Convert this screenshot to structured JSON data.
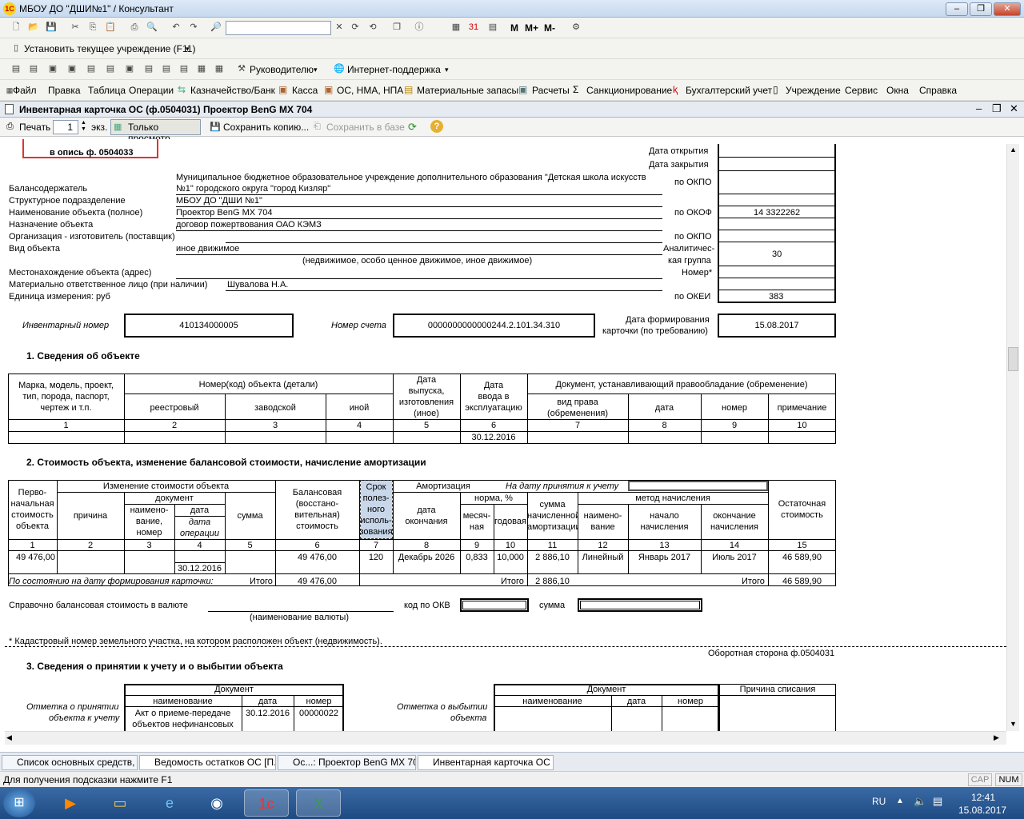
{
  "window": {
    "title": "МБОУ ДО \"ДШИ№1\" / Консультант"
  },
  "toolbar2": {
    "set_institution": "Установить текущее учреждение (F11)"
  },
  "toolbar3": {
    "managers": "Руководителю",
    "internet_support": "Интернет-поддержка"
  },
  "toolbar1": {
    "m1": "M",
    "m2": "M+",
    "m3": "M-"
  },
  "menu": [
    "Файл",
    "Правка",
    "Таблица",
    "Операции",
    "Казначейство/Банк",
    "Касса",
    "ОС, НМА, НПА",
    "Материальные запасы",
    "Расчеты",
    "Санкционирование",
    "Бухгалтерский учет",
    "Учреждение",
    "Сервис",
    "Окна",
    "Справка"
  ],
  "form": {
    "title": "Инвентарная карточка ОС (ф.0504031) Проектор BenG MX 704",
    "print": "Печать",
    "copies": "1",
    "copies_unit": "экз.",
    "view_only": "Только просмотр",
    "save_copy": "Сохранить копию...",
    "save_db": "Сохранить в базе",
    "help": "?"
  },
  "doc": {
    "stamp": "в опись ф. 0504033",
    "right": {
      "open_date": "Дата открытия",
      "close_date": "Дата закрытия",
      "okpo": "по ОКПО",
      "okof": "по ОКОФ",
      "okof_val": "14 3322262",
      "okpo2": "по ОКПО",
      "analytic1": "Аналитичес-",
      "analytic2": "кая группа",
      "analytic_val": "30",
      "number": "Номер*",
      "okei": "по ОКЕИ",
      "okei_val": "383"
    },
    "rows": {
      "holder_label": "Балансодержатель",
      "holder_val1": "Муниципальное бюджетное образовательное учреждение дополнительного образования  \"Детская школа искусств",
      "holder_val2": "№1\" городского округа \"город Кизляр\"",
      "unit_label": "Структурное подразделение",
      "unit_val": "МБОУ ДО \"ДШИ №1\"",
      "name_label": "Наименование объекта (полное)",
      "name_val": "Проектор BenG MX 704",
      "purpose_label": "Назначение объекта",
      "purpose_val": "договор пожертвования ОАО КЭМЗ",
      "maker_label": "Организация - изготовитель (поставщик)",
      "type_label": "Вид объекта",
      "type_val": "иное движимое",
      "type_hint": "(недвижимое, особо ценное движимое, иное движимое)",
      "location_label": "Местонахождение объекта (адрес)",
      "responsible_label": "Материально ответственное лицо (при наличии)",
      "responsible_val": "Шувалова Н.А.",
      "measure_label": "Единица измерения: руб"
    },
    "inv": {
      "inv_label": "Инвентарный номер",
      "inv_val": "410134000005",
      "acc_label": "Номер счета",
      "acc_val": "0000000000000244.2.101.34.310",
      "date_label1": "Дата формирования",
      "date_label2": "карточки (по требованию)",
      "date_val": "15.08.2017"
    },
    "s1": {
      "title": "1. Сведения об объекте",
      "h_brand": [
        "Марка, модель, проект,",
        "тип, порода, паспорт,",
        "чертеж и т.п."
      ],
      "h_number": "Номер(код) объекта (детали)",
      "h_reg": "реестровый",
      "h_factory": "заводской",
      "h_other": "иной",
      "h_release": [
        "Дата",
        "выпуска,",
        "изготовления",
        "(иное)"
      ],
      "h_commission": [
        "Дата",
        "ввода в",
        "эксплуатацию"
      ],
      "h_doc": "Документ, устанавливающий правообладание (обременение)",
      "h_right": [
        "вид права",
        "(обременения)"
      ],
      "h_date": "дата",
      "h_num": "номер",
      "h_note": "примечание",
      "nums": [
        "1",
        "2",
        "3",
        "4",
        "5",
        "6",
        "7",
        "8",
        "9",
        "10"
      ],
      "commission_val": "30.12.2016"
    },
    "s2": {
      "title": "2. Стоимость объекта, изменение балансовой стоимости, начисление амортизации",
      "h_initial": [
        "Перво-",
        "начальная",
        "стоимость",
        "объекта"
      ],
      "h_change": "Изменение стоимости объекта",
      "h_reason": "причина",
      "h_document": "документ",
      "h_dname": [
        "наимено-",
        "вание,",
        "номер"
      ],
      "h_ddate": "дата",
      "h_ddate2": [
        "дата",
        "операции"
      ],
      "h_sum": "сумма",
      "h_balance": [
        "Балансовая",
        "(восстано-",
        "вительная)",
        "стоимость"
      ],
      "h_life": [
        "Срок",
        "полез-",
        "ного",
        "исполь-",
        "зования"
      ],
      "h_amort": "Амортизация",
      "h_on_date": "На дату принятия к учету",
      "h_end": [
        "дата",
        "окончания"
      ],
      "h_norm": "норма, %",
      "h_month": [
        "месяч-",
        "ная"
      ],
      "h_year": "годовая",
      "h_accrued": [
        "сумма",
        "начисленной",
        "амортизации"
      ],
      "h_method": "метод начисления",
      "h_mname": [
        "наимено-",
        "вание"
      ],
      "h_mstart": [
        "начало",
        "начисления"
      ],
      "h_mend": [
        "окончание",
        "начисления"
      ],
      "h_rest": [
        "Остаточная",
        "стоимость"
      ],
      "nums": [
        "1",
        "2",
        "3",
        "4",
        "5",
        "6",
        "7",
        "8",
        "9",
        "10",
        "11",
        "12",
        "13",
        "14",
        "15"
      ],
      "row": {
        "initial": "49 476,00",
        "opdate": "30.12.2016",
        "balance": "49 476,00",
        "life": "120",
        "end": "Декабрь 2026",
        "month": "0,833",
        "year": "10,000",
        "accrued": "2 886,10",
        "method": "Линейный",
        "start": "Январь 2017",
        "mend": "Июль 2017",
        "rest": "46 589,90"
      },
      "as_of": "По состоянию на дату формирования карточки:",
      "total": "Итого",
      "total_balance": "49 476,00",
      "total_accrued": "2 886,10",
      "total_rest": "46 589,90",
      "ref": "Справочно балансовая стоимость в валюте",
      "currency_hint": "(наименование валюты)",
      "okv": "код по ОКВ",
      "sum": "сумма",
      "footnote": "* Кадастровый номер земельного участка, на котором расположен объект (недвижимость).",
      "back": "Оборотная сторона ф.0504031"
    },
    "s3": {
      "title": "3. Сведения о принятии к учету и о выбытии объекта",
      "accept1": "Отметка о принятии",
      "accept2": "объекта к учету",
      "document": "Документ",
      "name": "наименование",
      "date": "дата",
      "number": "номер",
      "act1": "Акт о приеме-передаче",
      "act2": "объектов нефинансовых",
      "act_date": "30.12.2016",
      "act_num": "00000022",
      "dispose1": "Отметка о выбытии",
      "dispose2": "объекта",
      "reason": "Причина списания"
    }
  },
  "window_tabs": [
    "Список основных средств, ...",
    "Ведомость остатков ОС [П...",
    "Ос...: Проектор BenG MX 704",
    "Инвентарная карточка ОС (..."
  ],
  "status": {
    "hint": "Для получения подсказки нажмите F1",
    "cap": "CAP",
    "num": "NUM"
  },
  "taskbar": {
    "lang": "RU",
    "time": "12:41",
    "date": "15.08.2017"
  }
}
